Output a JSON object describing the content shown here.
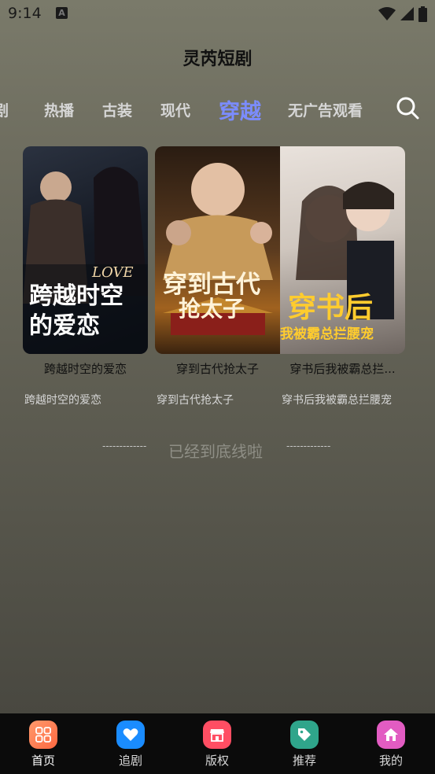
{
  "status_bar": {
    "time": "9:14",
    "notif_glyph": "A"
  },
  "app": {
    "title": "灵芮短剧"
  },
  "tabs": [
    {
      "label": "剧"
    },
    {
      "label": "热播"
    },
    {
      "label": "古装"
    },
    {
      "label": "现代"
    },
    {
      "label": "穿越"
    },
    {
      "label": "无广告观看"
    }
  ],
  "active_tab": "穿越",
  "dramas": [
    {
      "title": "跨越时空的爱恋",
      "subtitle": "跨越时空的爱恋",
      "poster_text": "跨越时空的爱恋",
      "poster_accent": "LOVE"
    },
    {
      "title": "穿到古代抢太子",
      "subtitle": "穿到古代抢太子",
      "poster_text_1": "穿到古代",
      "poster_text_2": "抢太子"
    },
    {
      "title": "穿书后我被霸总拦...",
      "subtitle": "穿书后我被霸总拦腰宠",
      "poster_text_1": "穿书后",
      "poster_text_2": "我被霸总拦腰宠"
    }
  ],
  "end_message": {
    "text": "已经到底线啦",
    "dash": "-------------"
  },
  "nav": [
    {
      "label": "首页",
      "icon": "home-grid-icon",
      "color": "#ff7a55"
    },
    {
      "label": "追剧",
      "icon": "heart-icon",
      "color": "#1a8cff"
    },
    {
      "label": "版权",
      "icon": "shop-icon",
      "color": "#ff4e63"
    },
    {
      "label": "推荐",
      "icon": "tag-icon",
      "color": "#2fa58b"
    },
    {
      "label": "我的",
      "icon": "house-icon",
      "color": "#e25cc2"
    }
  ],
  "colors": {
    "accent": "#7b8cff",
    "nav_bg": "#0b0b0b"
  }
}
